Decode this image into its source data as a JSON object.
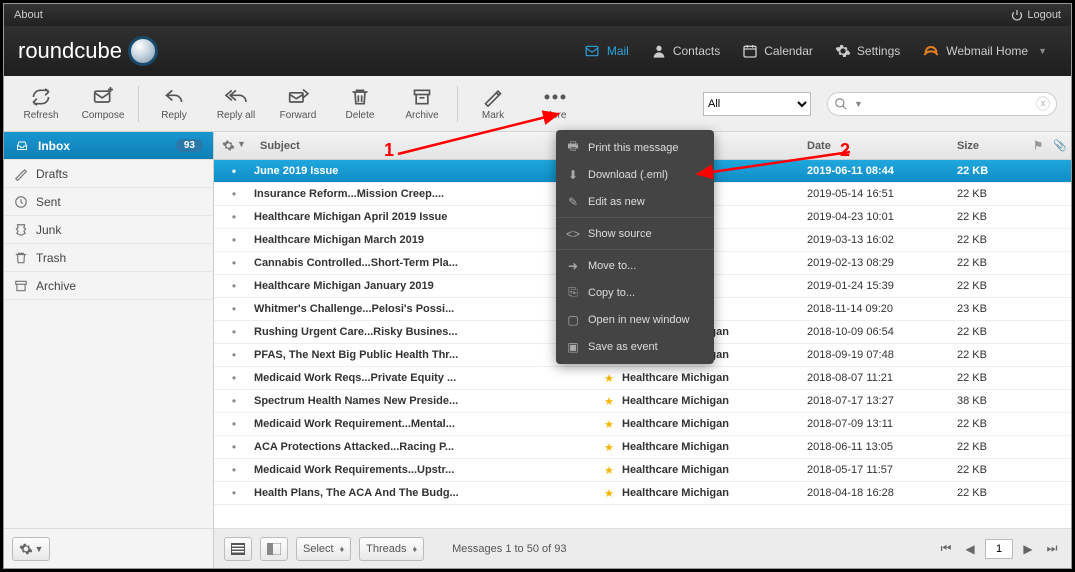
{
  "topbar": {
    "about": "About",
    "logout": "Logout"
  },
  "brand": "roundcube",
  "nav": [
    {
      "id": "mail",
      "label": "Mail",
      "active": true
    },
    {
      "id": "contacts",
      "label": "Contacts"
    },
    {
      "id": "calendar",
      "label": "Calendar"
    },
    {
      "id": "settings",
      "label": "Settings"
    },
    {
      "id": "webmail",
      "label": "Webmail Home"
    }
  ],
  "toolbar": {
    "refresh": "Refresh",
    "compose": "Compose",
    "reply": "Reply",
    "reply_all": "Reply all",
    "forward": "Forward",
    "delete": "Delete",
    "archive": "Archive",
    "mark": "Mark",
    "more": "More",
    "scope": "All"
  },
  "search": {
    "placeholder": ""
  },
  "folders": [
    {
      "id": "inbox",
      "label": "Inbox",
      "badge": "93",
      "active": true
    },
    {
      "id": "drafts",
      "label": "Drafts"
    },
    {
      "id": "sent",
      "label": "Sent"
    },
    {
      "id": "junk",
      "label": "Junk"
    },
    {
      "id": "trash",
      "label": "Trash"
    },
    {
      "id": "archive",
      "label": "Archive"
    }
  ],
  "columns": {
    "subject": "Subject",
    "date": "Date",
    "size": "Size"
  },
  "messages": [
    {
      "subject": "June 2019 Issue",
      "from": "",
      "date": "2019-06-11 08:44",
      "size": "22 KB",
      "star": false,
      "selected": true
    },
    {
      "subject": "Insurance Reform...Mission Creep....",
      "from": "",
      "date": "2019-05-14 16:51",
      "size": "22 KB",
      "star": false
    },
    {
      "subject": "Healthcare Michigan April 2019 Issue",
      "from": "",
      "date": "2019-04-23 10:01",
      "size": "22 KB",
      "star": false
    },
    {
      "subject": "Healthcare Michigan March 2019",
      "from": "",
      "date": "2019-03-13 16:02",
      "size": "22 KB",
      "star": false
    },
    {
      "subject": "Cannabis Controlled...Short-Term Pla...",
      "from": "",
      "date": "2019-02-13 08:29",
      "size": "22 KB",
      "star": false
    },
    {
      "subject": "Healthcare Michigan January 2019",
      "from": "",
      "date": "2019-01-24 15:39",
      "size": "22 KB",
      "star": false
    },
    {
      "subject": "Whitmer's Challenge...Pelosi's Possi...",
      "from": "",
      "date": "2018-11-14 09:20",
      "size": "23 KB",
      "star": false
    },
    {
      "subject": "Rushing Urgent Care...Risky Busines...",
      "from": "Healthcare Michigan",
      "date": "2018-10-09 06:54",
      "size": "22 KB",
      "star": true,
      "partial": true
    },
    {
      "subject": "PFAS, The Next Big Public Health Thr...",
      "from": "Healthcare Michigan",
      "date": "2018-09-19 07:48",
      "size": "22 KB",
      "star": true
    },
    {
      "subject": "Medicaid Work Reqs...Private Equity ...",
      "from": "Healthcare Michigan",
      "date": "2018-08-07 11:21",
      "size": "22 KB",
      "star": true
    },
    {
      "subject": "Spectrum Health Names New Preside...",
      "from": "Healthcare Michigan",
      "date": "2018-07-17 13:27",
      "size": "38 KB",
      "star": true
    },
    {
      "subject": "Medicaid Work Requirement...Mental...",
      "from": "Healthcare Michigan",
      "date": "2018-07-09 13:11",
      "size": "22 KB",
      "star": true
    },
    {
      "subject": "ACA Protections Attacked...Racing P...",
      "from": "Healthcare Michigan",
      "date": "2018-06-11 13:05",
      "size": "22 KB",
      "star": true
    },
    {
      "subject": "Medicaid Work Requirements...Upstr...",
      "from": "Healthcare Michigan",
      "date": "2018-05-17 11:57",
      "size": "22 KB",
      "star": true
    },
    {
      "subject": "Health Plans, The ACA And The Budg...",
      "from": "Healthcare Michigan",
      "date": "2018-04-18 16:28",
      "size": "22 KB",
      "star": true
    }
  ],
  "menu": [
    {
      "icon": "print",
      "label": "Print this message"
    },
    {
      "icon": "download",
      "label": "Download (.eml)",
      "hl": true
    },
    {
      "icon": "edit",
      "label": "Edit as new"
    },
    {
      "sep": true
    },
    {
      "icon": "source",
      "label": "Show source"
    },
    {
      "sep": true
    },
    {
      "icon": "move",
      "label": "Move to..."
    },
    {
      "icon": "copy",
      "label": "Copy to..."
    },
    {
      "icon": "open",
      "label": "Open in new window"
    },
    {
      "icon": "event",
      "label": "Save as event"
    }
  ],
  "status": {
    "select": "Select",
    "threads": "Threads",
    "text": "Messages 1 to 50 of 93",
    "page": "1"
  },
  "annotations": {
    "one": "1",
    "two": "2"
  }
}
